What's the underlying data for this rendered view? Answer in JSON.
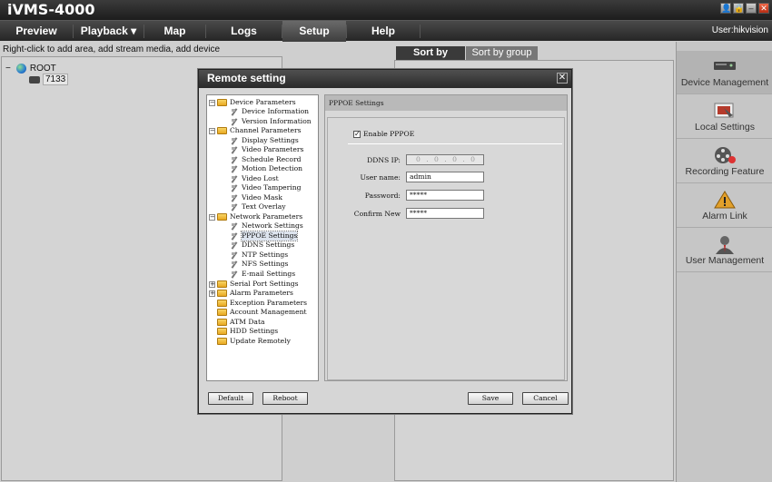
{
  "app": {
    "title": "iVMS-4000",
    "user": "User:hikvision"
  },
  "window_buttons": [
    {
      "name": "user-icon",
      "glyph": "👤"
    },
    {
      "name": "lock-icon",
      "glyph": "🔒"
    },
    {
      "name": "minimize-icon",
      "glyph": "–"
    },
    {
      "name": "close-icon",
      "glyph": "✕"
    }
  ],
  "menu": {
    "preview": "Preview",
    "playback": "Playback",
    "playback_arrow": "▾",
    "map": "Map",
    "logs": "Logs",
    "setup": "Setup",
    "help": "Help"
  },
  "left": {
    "hint": "Right-click to add area, add stream media, add device",
    "root_expander": "−",
    "root_label": "ROOT",
    "device_label": "7133"
  },
  "sort_tabs": {
    "by_camera": "Sort by camera",
    "by_group": "Sort by group"
  },
  "sidebar": {
    "items": [
      {
        "label": "Device Management",
        "icon": "device-icon"
      },
      {
        "label": "Local Settings",
        "icon": "settings-icon"
      },
      {
        "label": "Recording Feature",
        "icon": "film-reel-icon"
      },
      {
        "label": "Alarm Link",
        "icon": "warning-icon"
      },
      {
        "label": "User Management",
        "icon": "user-icon"
      }
    ]
  },
  "dialog": {
    "title": "Remote setting",
    "close_glyph": "✕",
    "tree": {
      "device_parameters": "Device Parameters",
      "device_information": "Device Information",
      "version_information": "Version Information",
      "channel_parameters": "Channel Parameters",
      "display_settings": "Display Settings",
      "video_parameters": "Video Parameters",
      "schedule_record": "Schedule Record",
      "motion_detection": "Motion Detection",
      "video_lost": "Video Lost",
      "video_tampering": "Video Tampering",
      "video_mask": "Video Mask",
      "text_overlay": "Text Overlay",
      "network_parameters": "Network Parameters",
      "network_settings": "Network Settings",
      "pppoe_settings": "PPPOE Settings",
      "ddns_settings": "DDNS Settings",
      "ntp_settings": "NTP Settings",
      "nfs_settings": "NFS Settings",
      "email_settings": "E-mail Settings",
      "serial_port_settings": "Serial Port Settings",
      "alarm_parameters": "Alarm Parameters",
      "exception_parameters": "Exception Parameters",
      "account_management": "Account Management",
      "atm_data": "ATM Data",
      "hdd_settings": "HDD Settings",
      "update_remotely": "Update Remotely",
      "minus": "−",
      "plus": "+"
    },
    "content": {
      "header": "PPPOE Settings",
      "enable_label": "Enable PPPOE",
      "enable_checked": "✓",
      "ddns_ip_label": "DDNS IP:",
      "ddns_ip_value": "0 . 0 . 0 . 0",
      "username_label": "User name:",
      "username_value": "admin",
      "password_label": "Password:",
      "password_value": "*****",
      "confirm_label": "Confirm New",
      "confirm_value": "*****"
    },
    "buttons": {
      "default": "Default",
      "reboot": "Reboot",
      "save": "Save",
      "cancel": "Cancel"
    }
  }
}
